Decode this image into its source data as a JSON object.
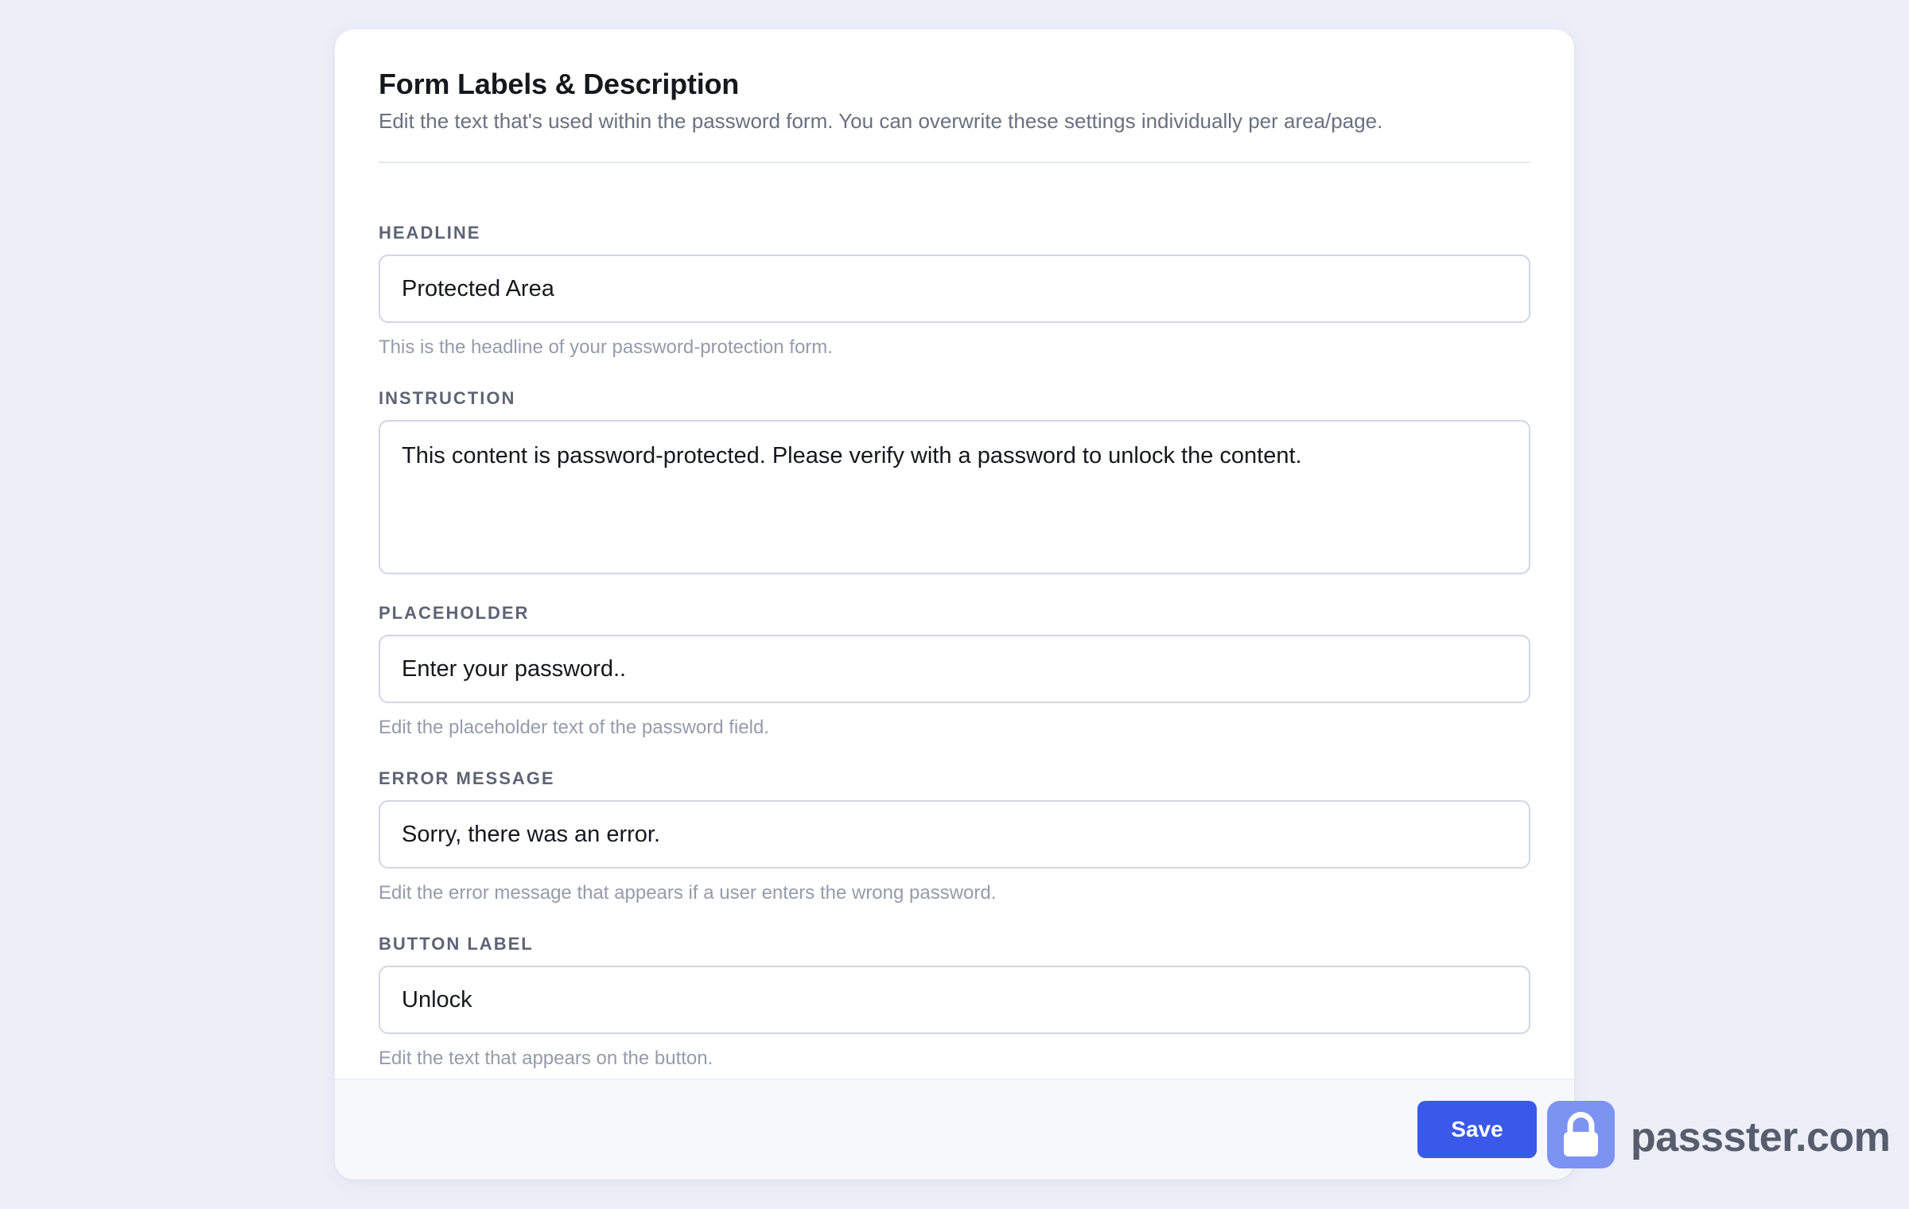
{
  "panel": {
    "title": "Form Labels & Description",
    "subtitle": "Edit the text that's used within the password form. You can overwrite these settings individually per area/page."
  },
  "fields": [
    {
      "label": "HEADLINE",
      "value": "Protected Area",
      "help": "This is the headline of your password-protection form."
    },
    {
      "label": "INSTRUCTION",
      "value": "This content is password-protected. Please verify with a password to unlock the content."
    },
    {
      "label": "PLACEHOLDER",
      "value": "Enter your password..",
      "help": "Edit the placeholder text of the password field."
    },
    {
      "label": "ERROR MESSAGE",
      "value": "Sorry, there was an error.",
      "help": "Edit the error message that appears if a user enters the wrong password."
    },
    {
      "label": "BUTTON LABEL",
      "value": "Unlock",
      "help": "Edit the text that appears on the button."
    }
  ],
  "footer": {
    "save_label": "Save"
  },
  "brand": {
    "text": "passster.com",
    "logo_icon": "padlock-icon",
    "logo_color": "#7c93f2"
  },
  "colors": {
    "accent": "#3a59ea",
    "page_background": "#eceef8"
  }
}
